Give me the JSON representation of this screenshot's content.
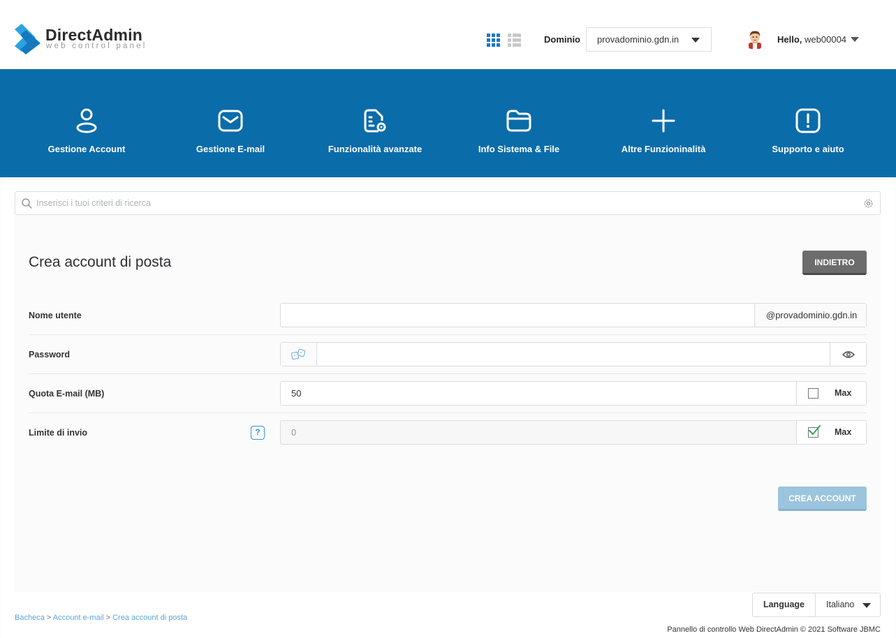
{
  "brand": {
    "title": "DirectAdmin",
    "subtitle": "web control panel",
    "colors": {
      "primary": "#0b6caa",
      "logo_light": "#2aa3e0",
      "logo_dark": "#1579be"
    }
  },
  "header": {
    "domain_label": "Dominio",
    "domain_value": "provadominio.gdn.in",
    "greeting": "Hello,",
    "username": "web00004",
    "icons": [
      "grid-view-icon",
      "list-view-icon",
      "avatar-icon",
      "chevron-down-icon"
    ]
  },
  "nav": {
    "items": [
      {
        "label": "Gestione Account",
        "icon": "user-icon"
      },
      {
        "label": "Gestione E-mail",
        "icon": "envelope-icon"
      },
      {
        "label": "Funzionalità avanzate",
        "icon": "file-settings-icon"
      },
      {
        "label": "Info Sistema & File",
        "icon": "folder-icon"
      },
      {
        "label": "Altre Funzioninalità",
        "icon": "plus-icon"
      },
      {
        "label": "Supporto e aiuto",
        "icon": "alert-icon"
      }
    ]
  },
  "search": {
    "placeholder": "Inserisci i tuoi criteri di ricerca"
  },
  "page": {
    "title": "Crea account di posta",
    "back_button": "INDIETRO",
    "create_button": "CREA ACCOUNT"
  },
  "form": {
    "username": {
      "label": "Nome utente",
      "value": "",
      "suffix": "@provadominio.gdn.in"
    },
    "password": {
      "label": "Password",
      "value": ""
    },
    "quota": {
      "label": "Quota E-mail (MB)",
      "value": "50",
      "max_label": "Max",
      "max_checked": false
    },
    "send_limit": {
      "label": "Limite di invio",
      "value": "0",
      "max_label": "Max",
      "max_checked": true,
      "help": "?"
    }
  },
  "footer": {
    "language_label": "Language",
    "language_value": "Italiano",
    "breadcrumb": [
      "Bacheca",
      "Account e-mail",
      "Crea account di posta"
    ],
    "breadcrumb_separator": ">",
    "copyright": "Pannello di controllo Web DirectAdmin © 2021 Software JBMC"
  }
}
